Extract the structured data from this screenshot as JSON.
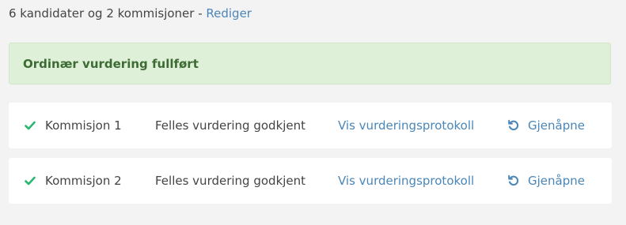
{
  "summary": {
    "text": "6 kandidater og 2 kommisjoner - ",
    "edit_label": "Rediger"
  },
  "alert": {
    "text": "Ordinær vurdering fullført",
    "color": "#dff0d8",
    "text_color": "#3c6b33"
  },
  "commissions": [
    {
      "name": "Kommisjon 1",
      "status": "Felles vurdering godkjent",
      "protocol_label": "Vis vurderingsprotokoll",
      "reopen_label": "Gjenåpne",
      "status_icon": "check-icon",
      "action_icon": "undo-icon"
    },
    {
      "name": "Kommisjon 2",
      "status": "Felles vurdering godkjent",
      "protocol_label": "Vis vurderingsprotokoll",
      "reopen_label": "Gjenåpne",
      "status_icon": "check-icon",
      "action_icon": "undo-icon"
    }
  ],
  "colors": {
    "accent": "#4a86b8",
    "check": "#2bb673"
  }
}
